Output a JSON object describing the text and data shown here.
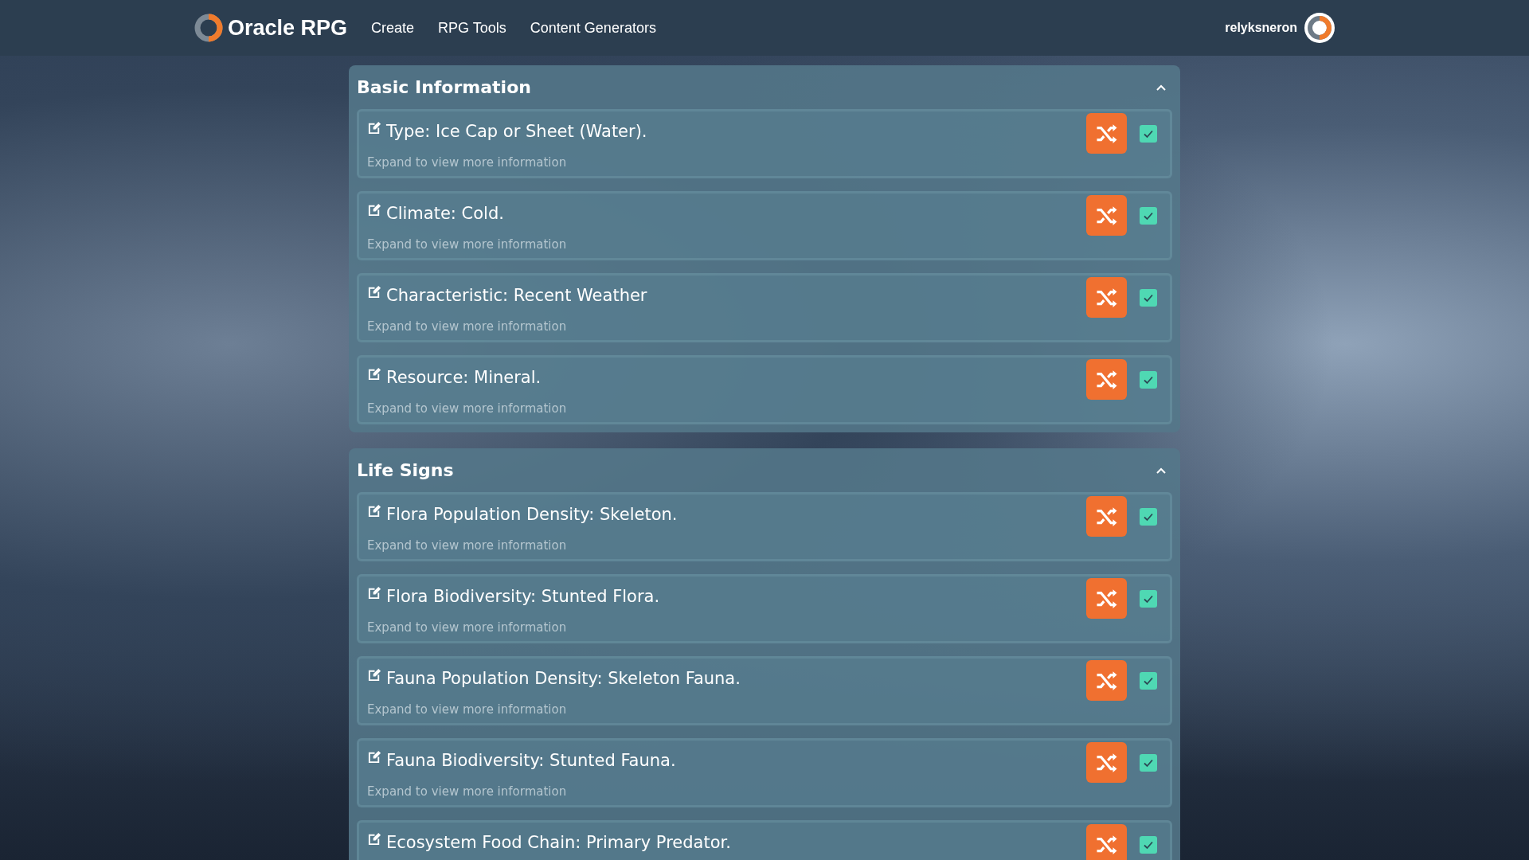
{
  "nav": {
    "brand": "Oracle RPG",
    "links": [
      "Create",
      "RPG Tools",
      "Content Generators"
    ],
    "user": "relyksneron"
  },
  "sections": [
    {
      "title": "Basic Information",
      "expanded": true,
      "items": [
        {
          "title": "Type: Ice Cap or Sheet (Water).",
          "hint": "Expand to view more information",
          "checked": true
        },
        {
          "title": "Climate: Cold.",
          "hint": "Expand to view more information",
          "checked": true
        },
        {
          "title": "Characteristic: Recent Weather",
          "hint": "Expand to view more information",
          "checked": true
        },
        {
          "title": "Resource: Mineral.",
          "hint": "Expand to view more information",
          "checked": true
        }
      ]
    },
    {
      "title": "Life Signs",
      "expanded": true,
      "items": [
        {
          "title": "Flora Population Density: Skeleton.",
          "hint": "Expand to view more information",
          "checked": true
        },
        {
          "title": "Flora Biodiversity: Stunted Flora.",
          "hint": "Expand to view more information",
          "checked": true
        },
        {
          "title": "Fauna Population Density: Skeleton Fauna.",
          "hint": "Expand to view more information",
          "checked": true
        },
        {
          "title": "Fauna Biodiversity: Stunted Fauna.",
          "hint": "Expand to view more information",
          "checked": true
        },
        {
          "title": "Ecosystem Food Chain: Primary Predator.",
          "checked": true
        }
      ]
    }
  ]
}
